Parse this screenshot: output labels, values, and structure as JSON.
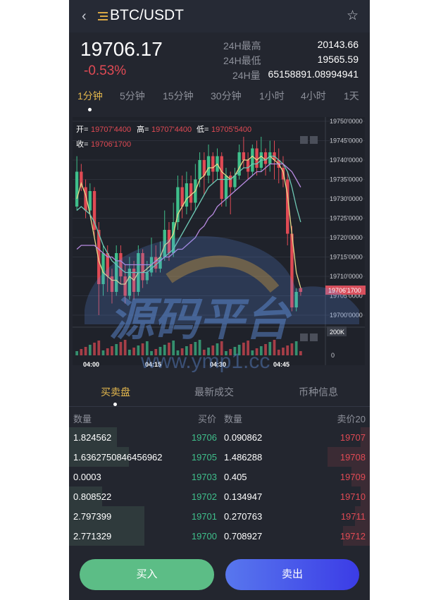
{
  "header": {
    "pair": "BTC/USDT",
    "back_icon": "chevron-left-icon",
    "menu_icon": "menu-icon",
    "fav_icon": "star-icon"
  },
  "ticker": {
    "last_price": "19706.17",
    "change": "-0.53%",
    "high_label": "24H最高",
    "high": "20143.66",
    "low_label": "24H最低",
    "low": "19565.59",
    "vol_label": "24H量",
    "vol": "65158891.08994941"
  },
  "intervals": [
    "1分钟",
    "5分钟",
    "15分钟",
    "30分钟",
    "1小时",
    "4小时",
    "1天"
  ],
  "active_interval": "1分钟",
  "chart_legend": {
    "open_label": "开=",
    "open": "19707'4400",
    "high_label": "高=",
    "high": "19707'4400",
    "low_label": "低=",
    "low": "19705'5400",
    "close_label": "收=",
    "close": "19706'1700"
  },
  "chart_data": {
    "type": "candlestick",
    "y_ticks": [
      "19750'0000",
      "19745'0000",
      "19740'0000",
      "19735'0000",
      "19730'0000",
      "19725'0000",
      "19720'0000",
      "19715'0000",
      "19710'0000",
      "19705'0000",
      "19700'0000"
    ],
    "ylim": [
      19700,
      19750
    ],
    "price_tag": "19706'1700",
    "volume_label": "200K",
    "volume_zero": "0",
    "x_ticks": [
      "04:00",
      "04:15",
      "04:30",
      "04:45"
    ],
    "candles": [
      [
        19728,
        19737,
        19727,
        19741
      ],
      [
        19737,
        19733,
        19732,
        19739
      ],
      [
        19733,
        19727,
        19725,
        19735
      ],
      [
        19727,
        19732,
        19726,
        19734
      ],
      [
        19732,
        19722,
        19720,
        19733
      ],
      [
        19722,
        19708,
        19700,
        19724
      ],
      [
        19708,
        19716,
        19705,
        19718
      ],
      [
        19716,
        19710,
        19706,
        19718
      ],
      [
        19710,
        19706,
        19703,
        19712
      ],
      [
        19706,
        19716,
        19705,
        19718
      ],
      [
        19716,
        19710,
        19708,
        19718
      ],
      [
        19710,
        19705,
        19703,
        19713
      ],
      [
        19705,
        19712,
        19704,
        19715
      ],
      [
        19712,
        19706,
        19704,
        19714
      ],
      [
        19706,
        19716,
        19705,
        19718
      ],
      [
        19716,
        19709,
        19707,
        19717
      ],
      [
        19709,
        19711,
        19708,
        19714
      ],
      [
        19711,
        19715,
        19710,
        19720
      ],
      [
        19715,
        19712,
        19711,
        19718
      ],
      [
        19712,
        19715,
        19711,
        19719
      ],
      [
        19715,
        19722,
        19714,
        19727
      ],
      [
        19722,
        19716,
        19714,
        19724
      ],
      [
        19716,
        19724,
        19715,
        19729
      ],
      [
        19724,
        19733,
        19722,
        19736
      ],
      [
        19733,
        19728,
        19725,
        19736
      ],
      [
        19728,
        19734,
        19726,
        19737
      ],
      [
        19734,
        19729,
        19727,
        19736
      ],
      [
        19729,
        19735,
        19727,
        19739
      ],
      [
        19735,
        19740,
        19733,
        19742
      ],
      [
        19740,
        19736,
        19731,
        19742
      ],
      [
        19736,
        19741,
        19734,
        19744
      ],
      [
        19741,
        19737,
        19734,
        19742
      ],
      [
        19737,
        19741,
        19735,
        19743
      ],
      [
        19741,
        19730,
        19728,
        19742
      ],
      [
        19730,
        19736,
        19728,
        19738
      ],
      [
        19736,
        19733,
        19726,
        19737
      ],
      [
        19733,
        19736,
        19732,
        19738
      ],
      [
        19736,
        19742,
        19735,
        19744
      ],
      [
        19742,
        19740,
        19738,
        19746
      ],
      [
        19740,
        19737,
        19735,
        19742
      ],
      [
        19737,
        19743,
        19736,
        19744
      ],
      [
        19743,
        19738,
        19736,
        19745
      ],
      [
        19738,
        19742,
        19737,
        19746
      ],
      [
        19742,
        19739,
        19736,
        19743
      ],
      [
        19739,
        19742,
        19737,
        19745
      ],
      [
        19742,
        19740,
        19735,
        19745
      ],
      [
        19740,
        19738,
        19734,
        19743
      ],
      [
        19738,
        19735,
        19733,
        19741
      ],
      [
        19735,
        19721,
        19718,
        19737
      ],
      [
        19721,
        19702,
        19701,
        19723
      ],
      [
        19702,
        19706,
        19701,
        19707
      ],
      [
        19707,
        19706,
        19705,
        19707
      ]
    ],
    "ma_series": [
      {
        "color": "#e8d98a",
        "values": [
          19730,
          19734,
          19731,
          19726,
          19720,
          19714,
          19711,
          19710,
          19709,
          19709,
          19708,
          19708,
          19710,
          19709,
          19711,
          19711,
          19712,
          19713,
          19714,
          19715,
          19718,
          19719,
          19721,
          19726,
          19728,
          19730,
          19731,
          19732,
          19735,
          19736,
          19738,
          19738,
          19739,
          19737,
          19736,
          19735,
          19736,
          19738,
          19740,
          19740,
          19741,
          19740,
          19741,
          19740,
          19741,
          19740,
          19739,
          19737,
          19731,
          19721,
          19711,
          19707
        ]
      },
      {
        "color": "#6ec9b5",
        "values": [
          19727,
          19728,
          19727,
          19726,
          19724,
          19721,
          19718,
          19716,
          19714,
          19713,
          19712,
          19711,
          19711,
          19711,
          19711,
          19711,
          19711,
          19712,
          19713,
          19714,
          19715,
          19716,
          19717,
          19719,
          19721,
          19723,
          19725,
          19727,
          19729,
          19731,
          19733,
          19734,
          19735,
          19735,
          19735,
          19735,
          19736,
          19737,
          19738,
          19738,
          19739,
          19739,
          19740,
          19740,
          19741,
          19741,
          19740,
          19739,
          19737,
          19733,
          19728,
          19724
        ]
      },
      {
        "color": "#b88ae0",
        "values": [
          19717,
          19718,
          19718,
          19718,
          19718,
          19717,
          19716,
          19715,
          19715,
          19714,
          19714,
          19713,
          19713,
          19713,
          19713,
          19713,
          19713,
          19713,
          19714,
          19714,
          19715,
          19715,
          19716,
          19717,
          19717,
          19718,
          19719,
          19720,
          19722,
          19723,
          19725,
          19726,
          19728,
          19729,
          19730,
          19731,
          19732,
          19733,
          19734,
          19735,
          19736,
          19737,
          19737,
          19738,
          19739,
          19739,
          19739,
          19739,
          19738,
          19737,
          19735,
          19733
        ]
      }
    ]
  },
  "subtabs": [
    "买卖盘",
    "最新成交",
    "币种信息"
  ],
  "orderbook": {
    "headers": {
      "bid_qty": "数量",
      "bid_price": "买价",
      "ask_qty": "数量",
      "ask_price": "卖价20"
    },
    "rows": [
      {
        "bid_qty": "1.824562",
        "bid_price": "19706",
        "ask_qty": "0.090862",
        "ask_price": "19707",
        "bid_depth": 0.16,
        "ask_depth": 0.03
      },
      {
        "bid_qty": "1.6362750846456962",
        "bid_price": "19705",
        "ask_qty": "1.486288",
        "ask_price": "19708",
        "bid_depth": 0.2,
        "ask_depth": 0.14
      },
      {
        "bid_qty": "0.0003",
        "bid_price": "19703",
        "ask_qty": "0.405",
        "ask_price": "19709",
        "bid_depth": 0.0,
        "ask_depth": 0.06
      },
      {
        "bid_qty": "0.808522",
        "bid_price": "19702",
        "ask_qty": "0.134947",
        "ask_price": "19710",
        "bid_depth": 0.11,
        "ask_depth": 0.03
      },
      {
        "bid_qty": "2.797399",
        "bid_price": "19701",
        "ask_qty": "0.270763",
        "ask_price": "19711",
        "bid_depth": 0.25,
        "ask_depth": 0.05
      },
      {
        "bid_qty": "2.771329",
        "bid_price": "19700",
        "ask_qty": "0.708927",
        "ask_price": "19712",
        "bid_depth": 0.25,
        "ask_depth": 0.09
      }
    ]
  },
  "actions": {
    "buy": "买入",
    "sell": "卖出"
  },
  "watermark": {
    "title": "源码平台",
    "url": "www.ymp1.cc"
  },
  "colors": {
    "up": "#3fbf8b",
    "down": "#e04a54",
    "accent": "#e3b74d"
  }
}
